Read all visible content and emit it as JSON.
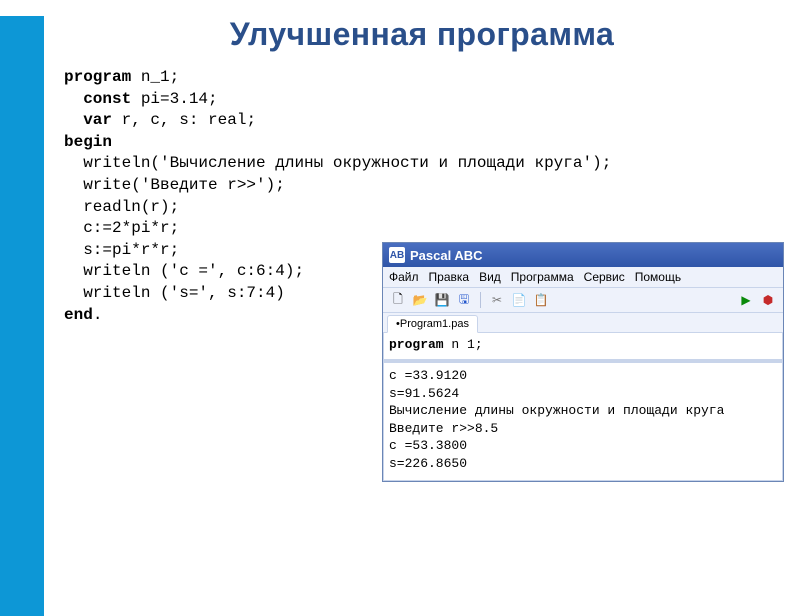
{
  "slide": {
    "title": "Улучшенная программа"
  },
  "code": {
    "l1a": "program",
    "l1b": " n_1;",
    "l2a": "  const",
    "l2b": " pi=3.14;",
    "l3a": "  var",
    "l3b": " r, c, s: real;",
    "l4": "begin",
    "l5": "  writeln('Вычисление длины окружности и площади круга');",
    "l6": "  write('Введите r>>');",
    "l7": "  readln(r);",
    "l8": "  c:=2*pi*r;",
    "l9": "  s:=pi*r*r;",
    "l10": "  writeln ('c =', c:6:4);",
    "l11": "  writeln ('s=', s:7:4)",
    "l12a": "end",
    "l12b": "."
  },
  "ide": {
    "app_name": "Pascal ABC",
    "logo": "AB",
    "menu": {
      "file": "Файл",
      "edit": "Правка",
      "view": "Вид",
      "program": "Программа",
      "service": "Сервис",
      "help": "Помощь"
    },
    "toolbar": {
      "new": "🗋",
      "open": "📂",
      "save": "💾",
      "saveall": "🖫",
      "cut": "✂",
      "copy": "📄",
      "paste": "📋",
      "run": "▶",
      "stop": "⬢"
    },
    "tab": "•Program1.pas",
    "editor_kw": "program",
    "editor_rest": " n 1;",
    "output": "c =33.9120\ns=91.5624\nВычисление длины окружности и площади круга\nВведите r>>8.5\nc =53.3800\ns=226.8650"
  }
}
